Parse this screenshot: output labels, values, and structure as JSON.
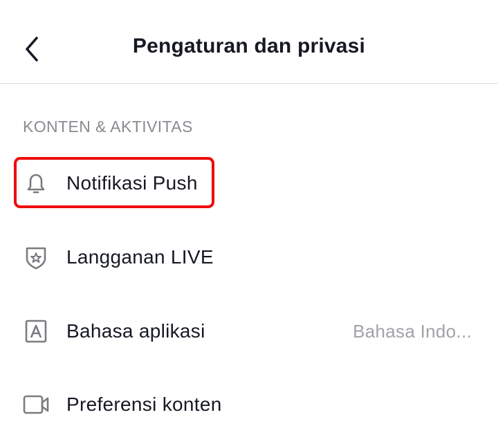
{
  "header": {
    "title": "Pengaturan dan privasi",
    "back_icon": "chevron-left-icon"
  },
  "section": {
    "title": "KONTEN & AKTIVITAS"
  },
  "items": [
    {
      "label": "Notifikasi Push",
      "icon": "bell-icon",
      "value": ""
    },
    {
      "label": "Langganan LIVE",
      "icon": "shield-star-icon",
      "value": ""
    },
    {
      "label": "Bahasa aplikasi",
      "icon": "language-a-icon",
      "value": "Bahasa Indo..."
    },
    {
      "label": "Preferensi konten",
      "icon": "video-camera-icon",
      "value": ""
    }
  ],
  "colors": {
    "highlight": "#ee0c0c",
    "text": "#161823",
    "section": "#8a8b91",
    "value": "#a1a2a7",
    "icon": "#7a7b80"
  }
}
